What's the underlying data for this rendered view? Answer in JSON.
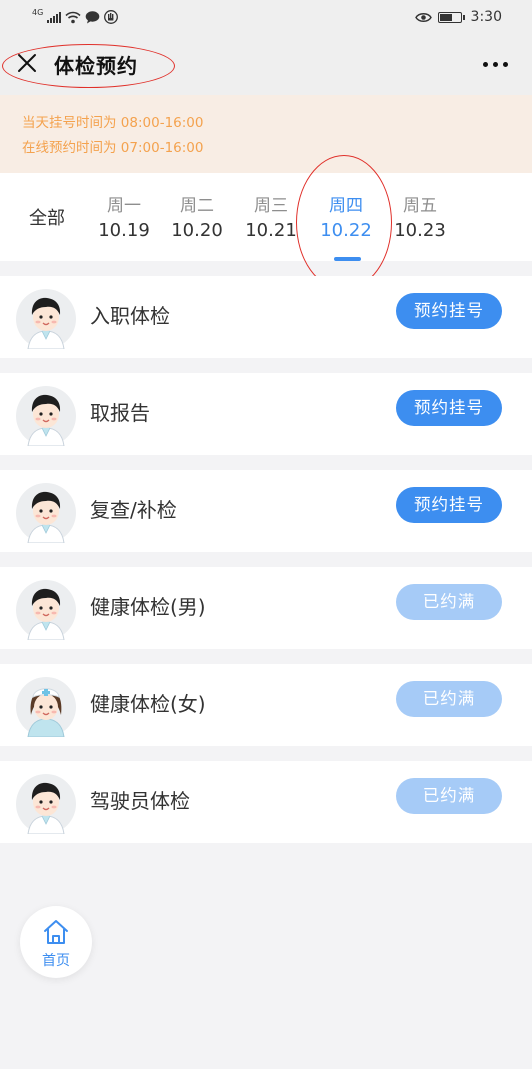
{
  "status_bar": {
    "network": "4G",
    "time": "3:30"
  },
  "nav": {
    "title": "体检预约",
    "close_icon": "close-icon",
    "more_icon": "more-icon"
  },
  "notice": {
    "line1": "当天挂号时间为 08:00-16:00",
    "line2": "在线预约时间为 07:00-16:00"
  },
  "date_filter": {
    "all_label": "全部",
    "days": [
      {
        "weekday": "周一",
        "date": "10.19",
        "active": false
      },
      {
        "weekday": "周二",
        "date": "10.20",
        "active": false
      },
      {
        "weekday": "周三",
        "date": "10.21",
        "active": false
      },
      {
        "weekday": "周四",
        "date": "10.22",
        "active": true
      },
      {
        "weekday": "周五",
        "date": "10.23",
        "active": false
      }
    ]
  },
  "services": [
    {
      "name": "入职体检",
      "action": "预约挂号",
      "available": true,
      "avatar": "male-doctor-avatar"
    },
    {
      "name": "取报告",
      "action": "预约挂号",
      "available": true,
      "avatar": "male-doctor-avatar"
    },
    {
      "name": "复查/补检",
      "action": "预约挂号",
      "available": true,
      "avatar": "male-doctor-avatar"
    },
    {
      "name": "健康体检(男)",
      "action": "已约满",
      "available": false,
      "avatar": "male-doctor-avatar"
    },
    {
      "name": "健康体检(女)",
      "action": "已约满",
      "available": false,
      "avatar": "female-nurse-avatar"
    },
    {
      "name": "驾驶员体检",
      "action": "已约满",
      "available": false,
      "avatar": "male-doctor-avatar"
    }
  ],
  "home_fab": {
    "label": "首页",
    "icon": "home-icon"
  },
  "colors": {
    "accent": "#3d8ef0",
    "accent_disabled": "#a6cbf7",
    "notice_text": "#f4a24e",
    "annotation": "#e0302a"
  }
}
